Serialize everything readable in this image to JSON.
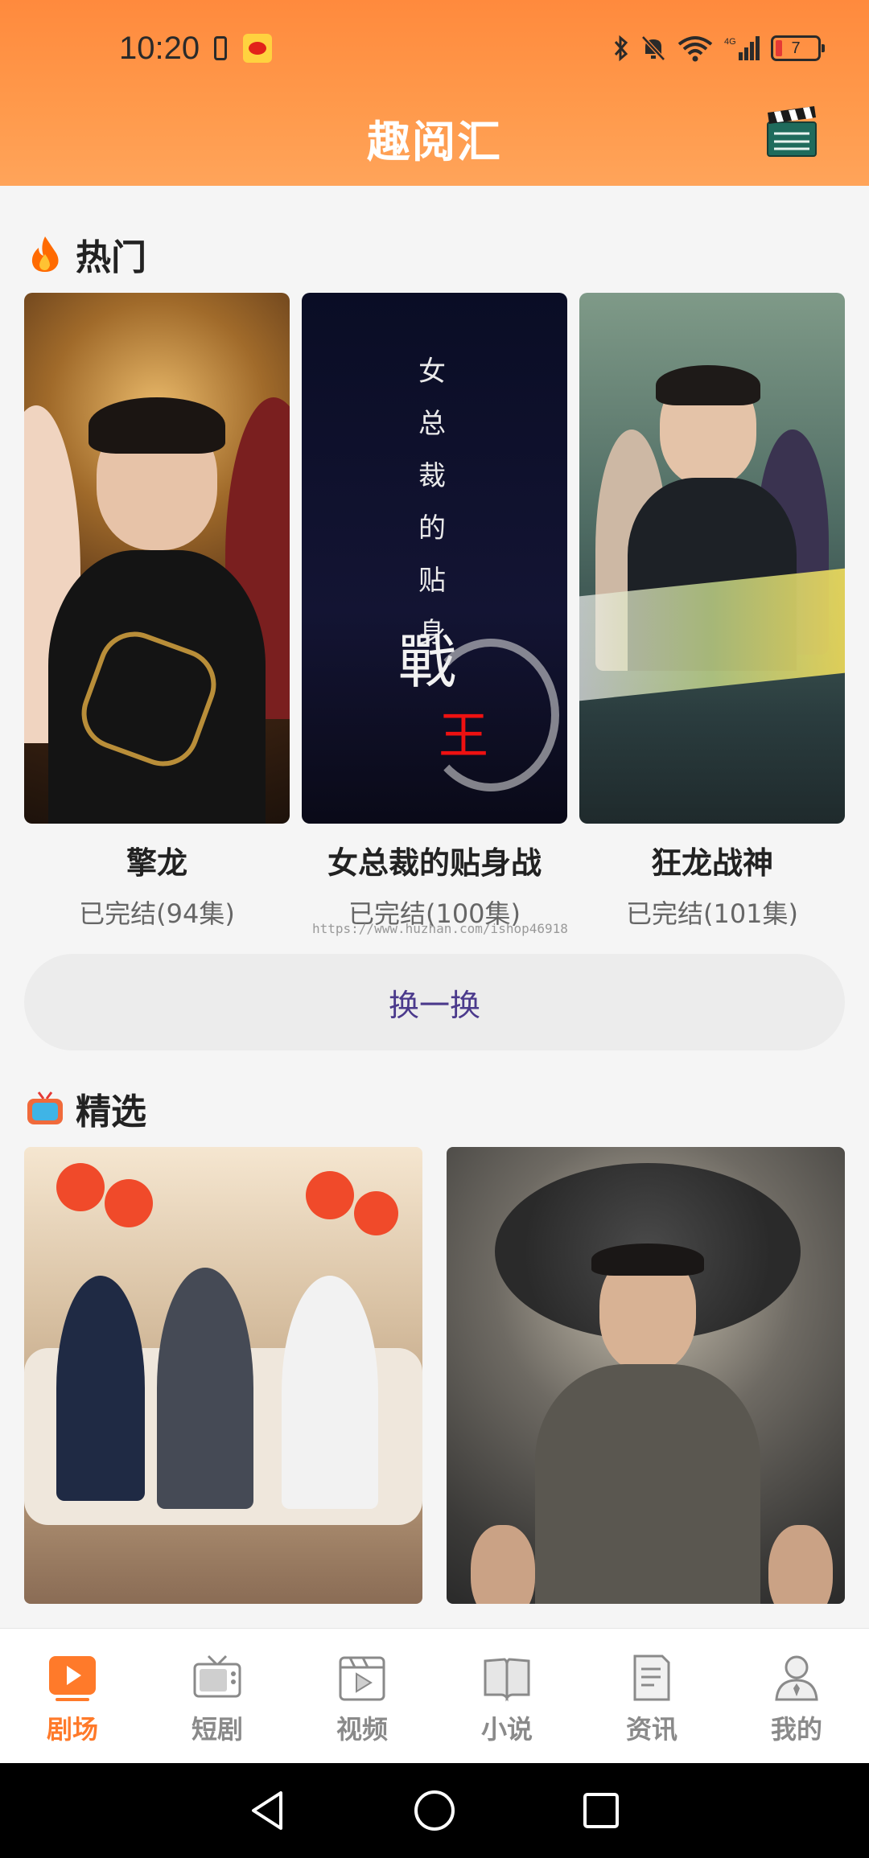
{
  "status_bar": {
    "time": "10:20",
    "battery_level": "7"
  },
  "header": {
    "title": "趣阅汇",
    "right_icon": "clapperboard-icon"
  },
  "hot_section": {
    "title": "热门",
    "icon": "fire-icon",
    "items": [
      {
        "name": "擎龙",
        "status": "已完结(94集)"
      },
      {
        "name": "女总裁的贴身战",
        "status": "已完结(100集)",
        "poster_vertical_text": [
          "女",
          "总",
          "裁",
          "的",
          "贴",
          "身"
        ],
        "poster_big_text_1": "戰",
        "poster_big_text_2": "王"
      },
      {
        "name": "狂龙战神",
        "status": "已完结(101集)"
      }
    ],
    "watermark": "https://www.huzhan.com/ishop46918",
    "refresh_label": "换一换"
  },
  "selected_section": {
    "title": "精选",
    "icon": "tv-icon"
  },
  "tabbar": {
    "items": [
      {
        "label": "剧场",
        "icon": "play-square-icon",
        "active": true
      },
      {
        "label": "短剧",
        "icon": "tv-set-icon",
        "active": false
      },
      {
        "label": "视频",
        "icon": "video-icon",
        "active": false
      },
      {
        "label": "小说",
        "icon": "book-icon",
        "active": false
      },
      {
        "label": "资讯",
        "icon": "document-icon",
        "active": false
      },
      {
        "label": "我的",
        "icon": "user-icon",
        "active": false
      }
    ]
  },
  "colors": {
    "brand_orange": "#ff8a3d",
    "tab_active": "#ff7a2a",
    "tab_inactive": "#8a8a8a",
    "refresh_text": "#4b3a8c"
  }
}
